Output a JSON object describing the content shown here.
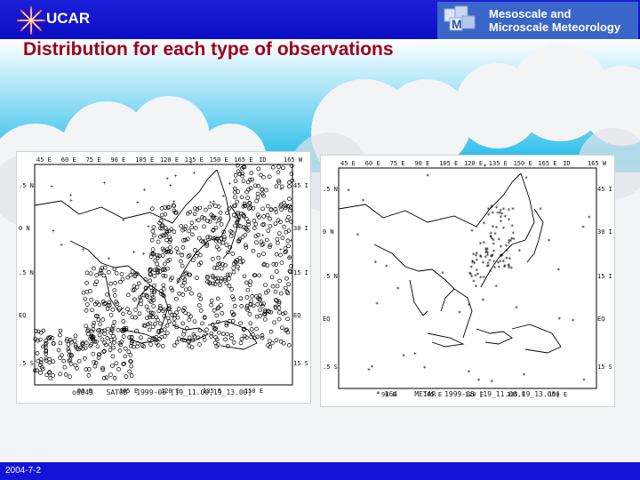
{
  "header": {
    "ucar_logo_text": "UCAR",
    "mmm_logo_line1": "Mesoscale and",
    "mmm_logo_line2": "Microscale Meteorology"
  },
  "slide": {
    "title": "Distribution for each type of observations",
    "footer_date": "2004-7-2"
  },
  "maps": {
    "left": {
      "top_ticks": [
        "45 E",
        "60 E",
        "75 E",
        "90 E",
        "105 E",
        "120 E",
        "135 E",
        "150 E",
        "165 E",
        "ID",
        "165 W"
      ],
      "bottom_ticks": [
        "90 E",
        "105 E",
        "120 E",
        "135 E",
        "150 E"
      ],
      "left_ticks": [
        ".5 N",
        "0 N",
        ".5 N",
        "EQ",
        ".5 S"
      ],
      "right_ticks": [
        "45 I",
        "30 I",
        "15 I",
        "EQ",
        "15 S"
      ],
      "caption": "o6043   SATOB  1999-08 [19_11.00,19_13.00]"
    },
    "right": {
      "top_ticks": [
        "45 E",
        "60 E",
        "75 E",
        "90 E",
        "105 E",
        "120 E",
        "135 E",
        "150 E",
        "165 E",
        "ID",
        "165 W"
      ],
      "bottom_ticks": [
        "90 E",
        "105 E",
        "120 E",
        "135 E",
        "150 E"
      ],
      "left_ticks": [
        ".5 N",
        "0 N",
        ".5 N",
        "EQ",
        ".5 S"
      ],
      "right_ticks": [
        "45 I",
        "30 I",
        "15 I",
        "EQ",
        "15 S"
      ],
      "caption": "* 164    METAR  1999-08 [19_11.00,19_13.00]"
    }
  }
}
